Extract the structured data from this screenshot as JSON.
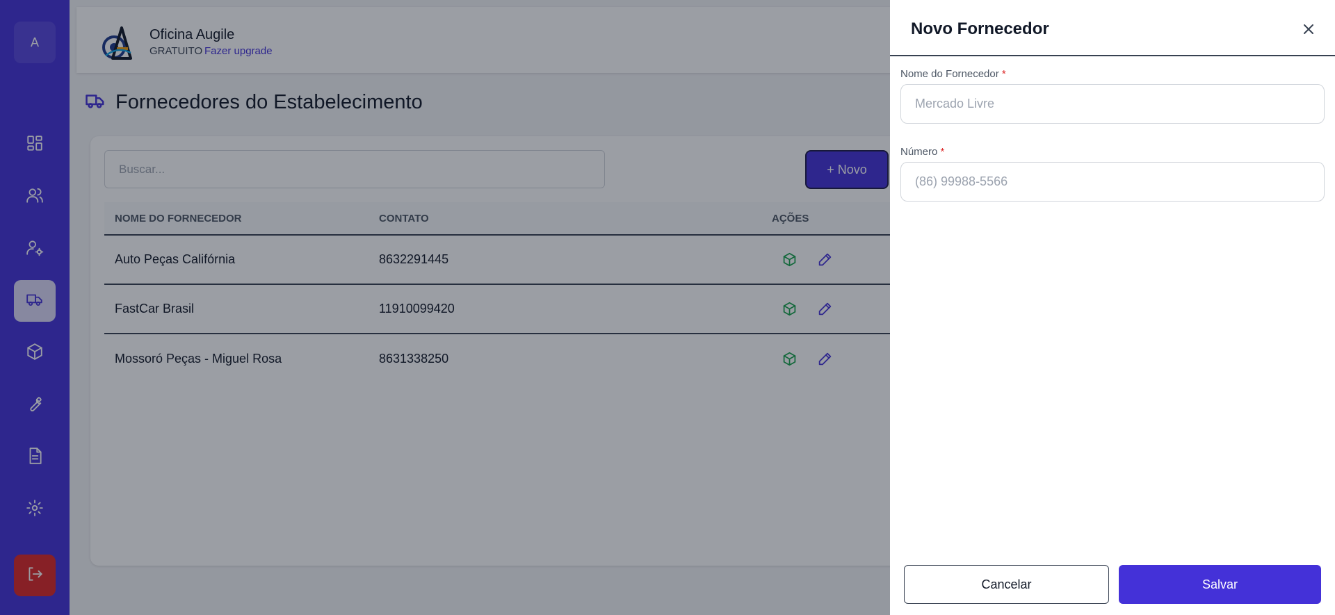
{
  "sidebar": {
    "avatar_initial": "A",
    "items": [
      {
        "name": "dashboard-icon"
      },
      {
        "name": "users-icon"
      },
      {
        "name": "user-gear-icon"
      },
      {
        "name": "truck-icon",
        "active": true
      },
      {
        "name": "box-icon"
      },
      {
        "name": "wrench-icon"
      },
      {
        "name": "document-icon"
      },
      {
        "name": "gear-icon"
      },
      {
        "name": "logout-icon"
      }
    ]
  },
  "header": {
    "brand_name": "Oficina Augile",
    "plan": "GRATUITO",
    "upgrade_label": "Fazer upgrade"
  },
  "page": {
    "title": "Fornecedores do Estabelecimento"
  },
  "toolbar": {
    "search_placeholder": "Buscar...",
    "new_label": "+ Novo"
  },
  "table": {
    "headers": {
      "name": "NOME DO FORNECEDOR",
      "contact": "CONTATO",
      "actions": "AÇÕES"
    },
    "rows": [
      {
        "name": "Auto Peças Califórnia",
        "contact": "8632291445"
      },
      {
        "name": "FastCar Brasil",
        "contact": "11910099420"
      },
      {
        "name": "Mossoró Peças - Miguel Rosa",
        "contact": "8631338250"
      }
    ]
  },
  "drawer": {
    "title": "Novo Fornecedor",
    "name_label": "Nome do Fornecedor",
    "name_required": "*",
    "name_placeholder": "Mercado Livre",
    "number_label": "Número",
    "number_required": "*",
    "number_placeholder": "(86) 99988-5566",
    "cancel_label": "Cancelar",
    "save_label": "Salvar"
  },
  "colors": {
    "primary": "#4431d8",
    "danger": "#dc2626",
    "success": "#16a34a"
  }
}
